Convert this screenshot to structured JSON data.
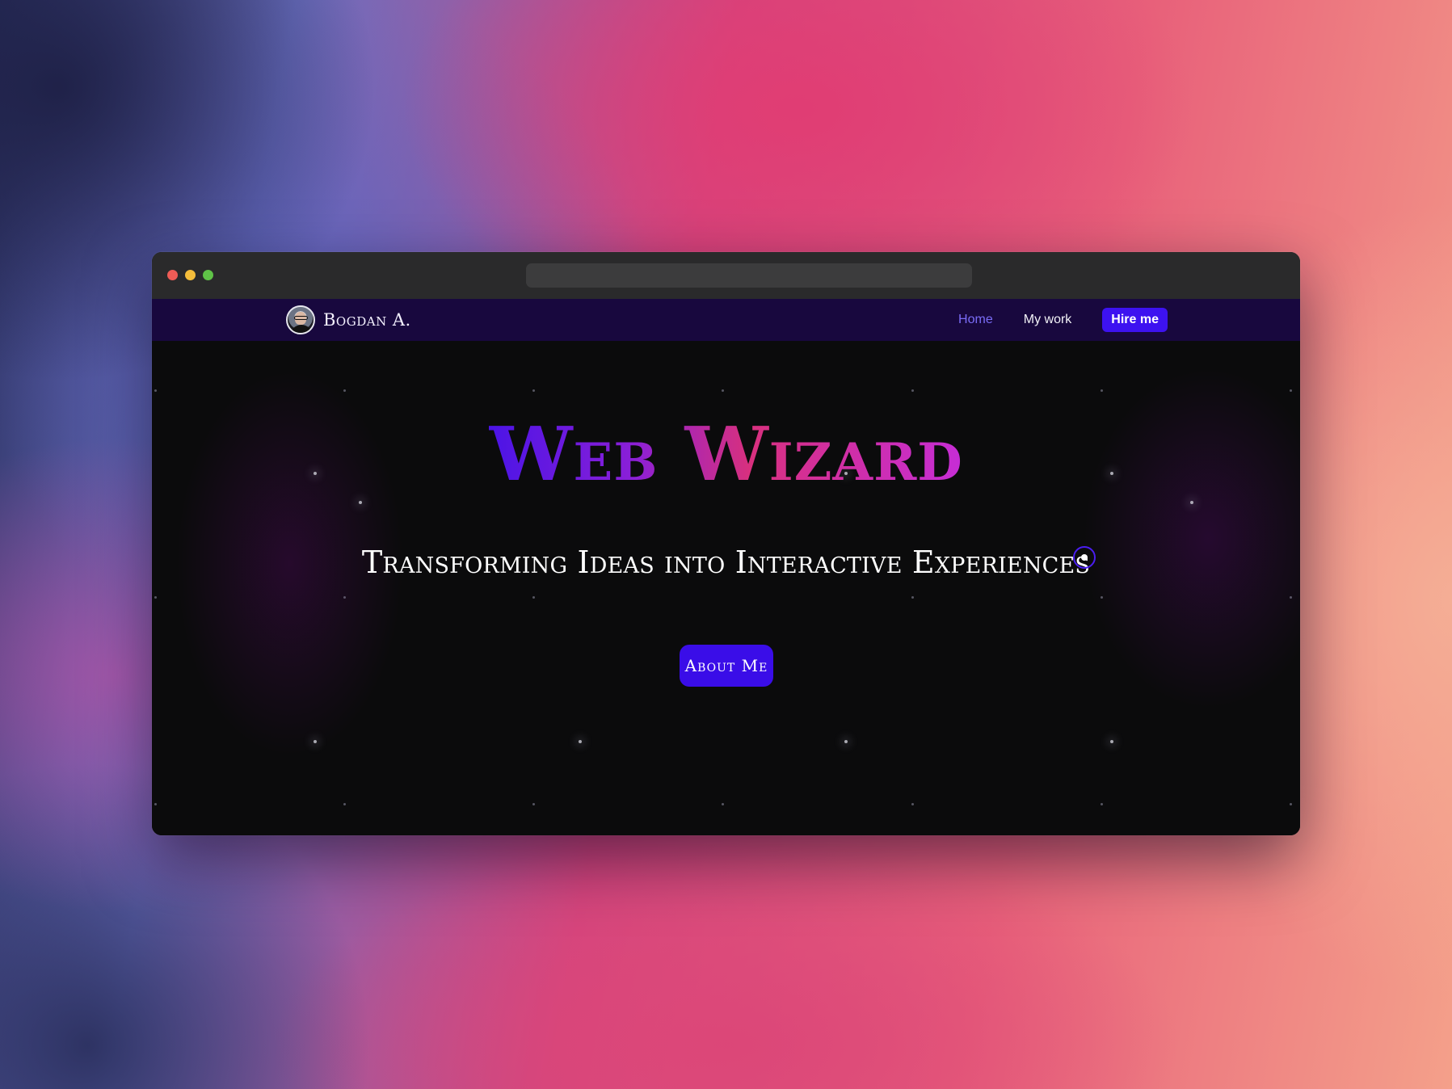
{
  "site": {
    "brand_name": "Bogdan A.",
    "nav": {
      "home": "Home",
      "my_work": "My work",
      "hire_me": "Hire me"
    }
  },
  "hero": {
    "title": "Web Wizard",
    "subtitle": "Transforming Ideas into Interactive Experiences",
    "cta": "About Me"
  },
  "colors": {
    "nav_background": "#18083e",
    "accent": "#3d12f0",
    "active_link": "#7a6cf6",
    "title_gradient_start": "#4b14e6",
    "title_gradient_end": "#c62dd6"
  }
}
